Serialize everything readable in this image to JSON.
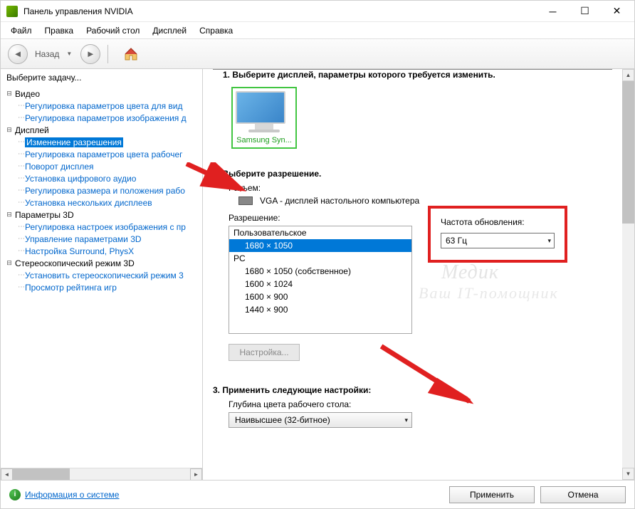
{
  "window": {
    "title": "Панель управления NVIDIA"
  },
  "menu": {
    "file": "Файл",
    "edit": "Правка",
    "desktop": "Рабочий стол",
    "display": "Дисплей",
    "help": "Справка"
  },
  "toolbar": {
    "back": "Назад"
  },
  "sidebar": {
    "header": "Выберите задачу...",
    "categories": {
      "video": "Видео",
      "display": "Дисплей",
      "params3d": "Параметры 3D",
      "stereo": "Стереоскопический режим 3D"
    },
    "items": {
      "video_color": "Регулировка параметров цвета для вид",
      "video_image": "Регулировка параметров изображения д",
      "change_res": "Изменение разрешения",
      "desktop_color": "Регулировка параметров цвета рабочег",
      "rotate": "Поворот дисплея",
      "digital_audio": "Установка цифрового аудио",
      "size_pos": "Регулировка размера и положения рабо",
      "multi_display": "Установка нескольких дисплеев",
      "img_settings": "Регулировка настроек изображения с пр",
      "manage_3d": "Управление параметрами 3D",
      "surround": "Настройка Surround, PhysX",
      "set_stereo": "Установить стереоскопический режим 3",
      "game_rating": "Просмотр рейтинга игр"
    }
  },
  "main": {
    "step1": "1. Выберите дисплей, параметры которого требуется изменить.",
    "display_name": "Samsung Syn...",
    "step2": "2. Выберите разрешение.",
    "connector_label": "Разъем:",
    "connector_value": "VGA - дисплей настольного компьютера",
    "resolution_label": "Разрешение:",
    "refresh_label": "Частота обновления:",
    "refresh_value": "63 Гц",
    "list_groups": {
      "custom": "Пользовательское",
      "pc": "PC"
    },
    "list_items": {
      "r1": "1680 × 1050",
      "r2": "1680 × 1050 (собственное)",
      "r3": "1600 × 1024",
      "r4": "1600 × 900",
      "r5": "1440 × 900"
    },
    "customize_btn": "Настройка...",
    "step3": "3. Применить следующие настройки:",
    "depth_label": "Глубина цвета рабочего стола:",
    "depth_value": "Наивысшее (32-битное)"
  },
  "footer": {
    "info_link": "Информация о системе",
    "apply": "Применить",
    "cancel": "Отмена"
  }
}
